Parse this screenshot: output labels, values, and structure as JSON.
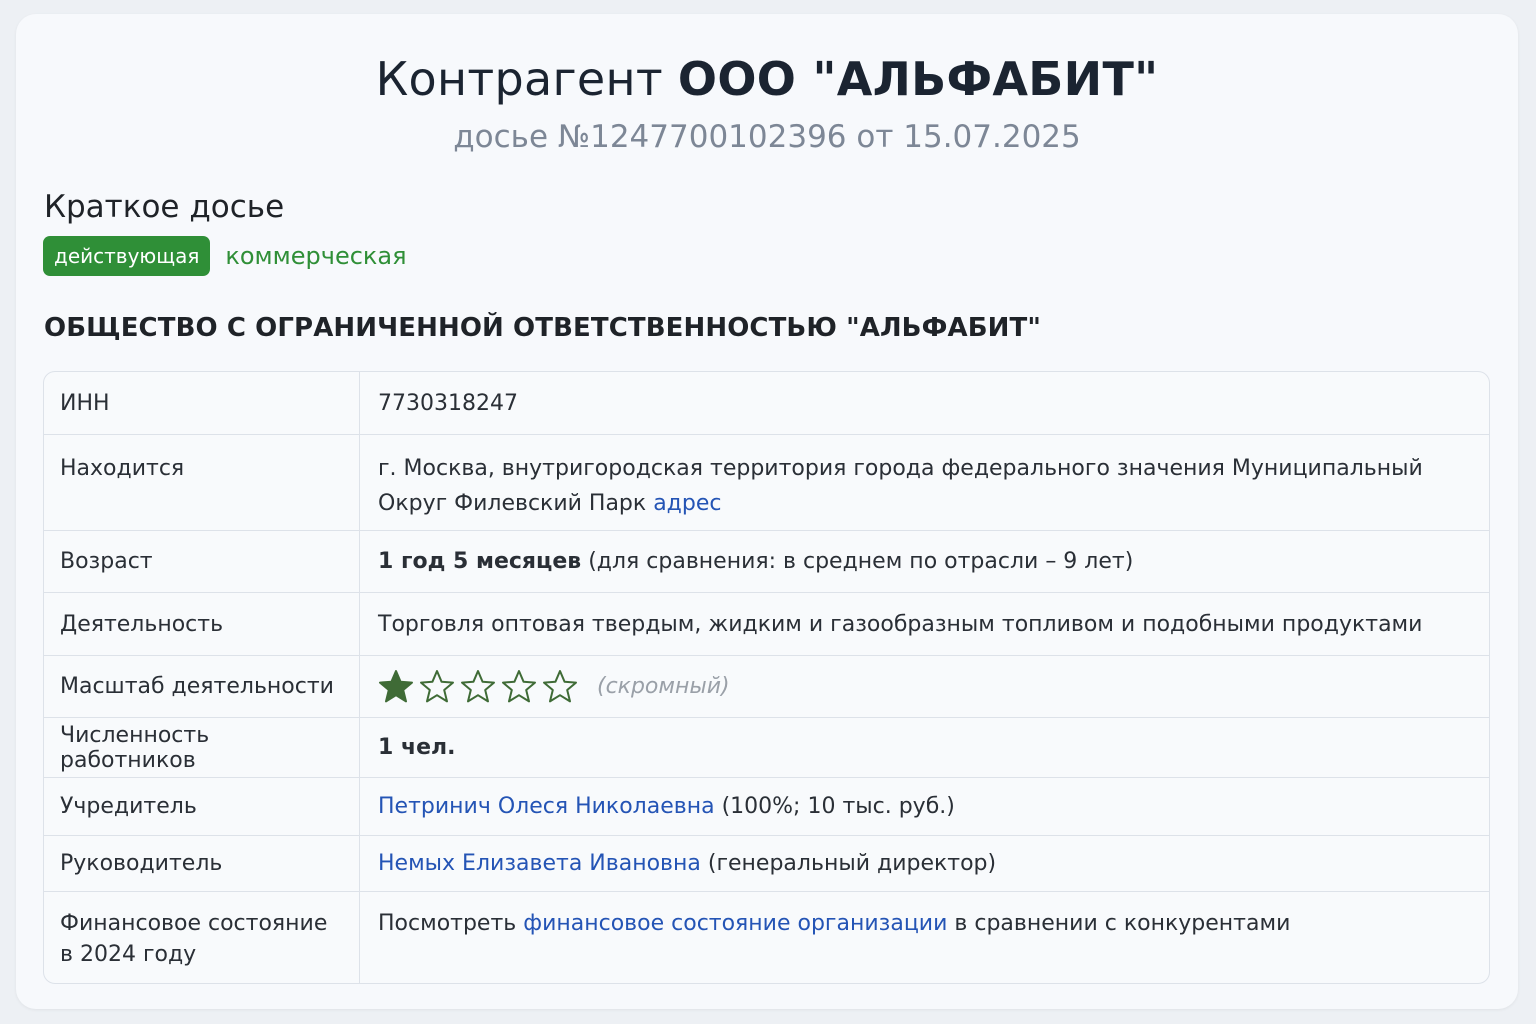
{
  "header": {
    "title_prefix": "Контрагент",
    "title_name": "ООО \"АЛЬФАБИТ\"",
    "subtitle": "досье №1247700102396 от 15.07.2025"
  },
  "summary": {
    "section_title": "Краткое досье",
    "status_badge": "действующая",
    "type_label": "коммерческая",
    "full_name": "ОБЩЕСТВО С ОГРАНИЧЕННОЙ ОТВЕТСТВЕННОСТЬЮ \"АЛЬФАБИТ\""
  },
  "table": {
    "inn": {
      "label": "ИНН",
      "value": "7730318247"
    },
    "location": {
      "label": "Находится",
      "value": "г. Москва, внутригородская территория города федерального значения Муниципальный Округ Филевский Парк",
      "link": "адрес"
    },
    "age": {
      "label": "Возраст",
      "value": "1 год 5 месяцев",
      "note": "(для сравнения: в среднем по отрасли – 9 лет)"
    },
    "activity": {
      "label": "Деятельность",
      "value": "Торговля оптовая твердым, жидким и газообразным топливом и подобными продуктами"
    },
    "scale": {
      "label": "Масштаб деятельности",
      "rating": 1,
      "max": 5,
      "note": "(скромный)"
    },
    "staff": {
      "label": "Численность работников",
      "value": "1 чел."
    },
    "founder": {
      "label": "Учредитель",
      "name": "Петринич Олеся Николаевна",
      "note": "(100%; 10 тыс. руб.)"
    },
    "head": {
      "label": "Руководитель",
      "name": "Немых Елизавета Ивановна",
      "note": "(генеральный директор)"
    },
    "finance": {
      "label": "Финансовое состояние в 2024 году",
      "prefix": "Посмотреть",
      "link": "финансовое состояние организации",
      "suffix": "в сравнении с конкурентами"
    }
  },
  "colors": {
    "accent_green": "#2f8f37",
    "link_blue": "#2454b5",
    "star_dark_green": "#3f6b36"
  },
  "icons": {
    "rating": "star-icon"
  }
}
